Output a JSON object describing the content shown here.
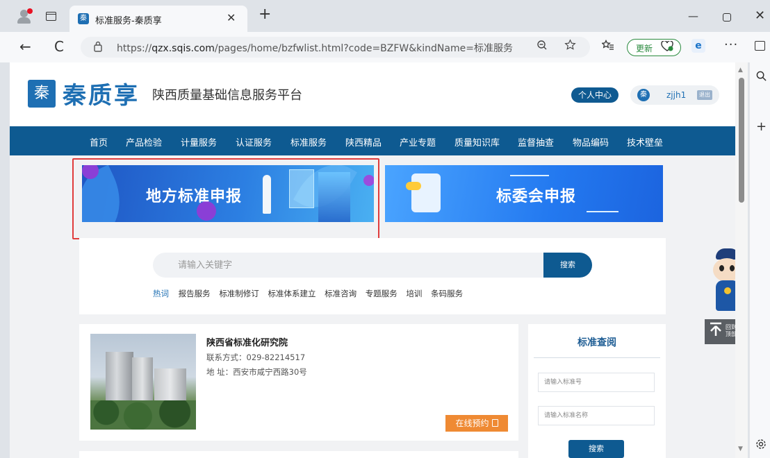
{
  "browser": {
    "tab_title": "标准服务-秦质享",
    "tab_favicon": "秦",
    "close_glyph": "✕",
    "new_tab_glyph": "+",
    "win_min_glyph": "—",
    "win_close_glyph": "✕",
    "back_glyph": "←",
    "refresh_glyph": "C",
    "url_prefix": "https://",
    "url_domain": "qzx.sqis.com",
    "url_path": "/pages/home/bzfwlist.html?code=BZFW&kindName=标准服务",
    "update_label": "更新",
    "more_glyph": "···"
  },
  "site": {
    "logo_badge": "秦",
    "logo_text": "秦质享",
    "subtitle": "陕西质量基础信息服务平台",
    "personal_center": "个人中心",
    "user_avatar": "秦",
    "username": "zjjh1",
    "logout": "退出"
  },
  "nav": [
    "首页",
    "产品检验",
    "计量服务",
    "认证服务",
    "标准服务",
    "陕西精品",
    "产业专题",
    "质量知识库",
    "监督抽查",
    "物品编码",
    "技术壁垒"
  ],
  "banners": {
    "left_title": "地方标准申报",
    "right_title": "标委会申报"
  },
  "search": {
    "placeholder": "请输入关键字",
    "button": "搜索",
    "hot_label": "热词",
    "hot_words": [
      "报告服务",
      "标准制修订",
      "标准体系建立",
      "标准咨询",
      "专题服务",
      "培训",
      "条码服务"
    ]
  },
  "org": {
    "name": "陕西省标准化研究院",
    "contact": "联系方式：029-82214517",
    "address": "地 址：西安市咸宁西路30号",
    "reserve": "在线预约"
  },
  "std_lookup": {
    "title": "标准查阅",
    "number_placeholder": "请输入标准号",
    "name_placeholder": "请输入标准名称",
    "button": "搜索"
  },
  "back_to_top": "回到顶部",
  "icons": {
    "zoom": "zoom-out-icon",
    "favorite": "star-icon",
    "favorites_list": "favorites-icon",
    "edge": "edge-icon",
    "search_sidebar": "search-icon",
    "settings": "gear-icon"
  },
  "colors": {
    "brand_blue": "#1e6fb3",
    "nav_bg": "#0e5a91",
    "reserve_orange": "#ef8a33",
    "highlight_red": "#e03c3c",
    "update_green": "#2a8a3e"
  }
}
